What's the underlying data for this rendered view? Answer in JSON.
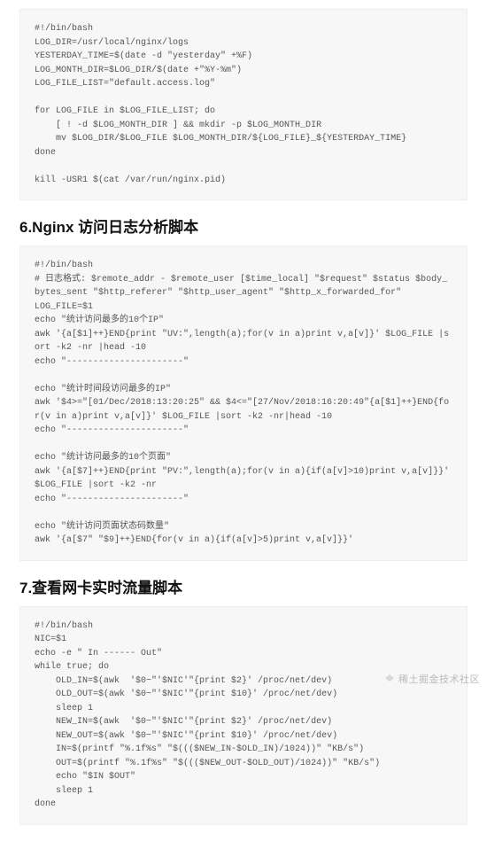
{
  "sections": [
    {
      "code": "#!/bin/bash\nLOG_DIR=/usr/local/nginx/logs\nYESTERDAY_TIME=$(date -d \"yesterday\" +%F)\nLOG_MONTH_DIR=$LOG_DIR/$(date +\"%Y-%m\")\nLOG_FILE_LIST=\"default.access.log\"\n\nfor LOG_FILE in $LOG_FILE_LIST; do\n    [ ! -d $LOG_MONTH_DIR ] && mkdir -p $LOG_MONTH_DIR\n    mv $LOG_DIR/$LOG_FILE $LOG_MONTH_DIR/${LOG_FILE}_${YESTERDAY_TIME}\ndone\n\nkill -USR1 $(cat /var/run/nginx.pid)"
    },
    {
      "heading": "6.Nginx 访问日志分析脚本",
      "code": "#!/bin/bash\n# 日志格式: $remote_addr - $remote_user [$time_local] \"$request\" $status $body_bytes_sent \"$http_referer\" \"$http_user_agent\" \"$http_x_forwarded_for\"\nLOG_FILE=$1\necho \"统计访问最多的10个IP\"\nawk '{a[$1]++}END{print \"UV:\",length(a);for(v in a)print v,a[v]}' $LOG_FILE |sort -k2 -nr |head -10\necho \"----------------------\"\n\necho \"统计时间段访问最多的IP\"\nawk '$4>=\"[01/Dec/2018:13:20:25\" && $4<=\"[27/Nov/2018:16:20:49\"{a[$1]++}END{for(v in a)print v,a[v]}' $LOG_FILE |sort -k2 -nr|head -10\necho \"----------------------\"\n\necho \"统计访问最多的10个页面\"\nawk '{a[$7]++}END{print \"PV:\",length(a);for(v in a){if(a[v]>10)print v,a[v]}}' $LOG_FILE |sort -k2 -nr\necho \"----------------------\"\n\necho \"统计访问页面状态码数量\"\nawk '{a[$7\" \"$9]++}END{for(v in a){if(a[v]>5)print v,a[v]}}'"
    },
    {
      "heading": "7.查看网卡实时流量脚本",
      "code": "#!/bin/bash\nNIC=$1\necho -e \" In ------ Out\"\nwhile true; do\n    OLD_IN=$(awk  '$0~\"'$NIC'\"{print $2}' /proc/net/dev)\n    OLD_OUT=$(awk '$0~\"'$NIC'\"{print $10}' /proc/net/dev)\n    sleep 1\n    NEW_IN=$(awk  '$0~\"'$NIC'\"{print $2}' /proc/net/dev)\n    NEW_OUT=$(awk '$0~\"'$NIC'\"{print $10}' /proc/net/dev)\n    IN=$(printf \"%.1f%s\" \"$((($NEW_IN-$OLD_IN)/1024))\" \"KB/s\")\n    OUT=$(printf \"%.1f%s\" \"$((($NEW_OUT-$OLD_OUT)/1024))\" \"KB/s\")\n    echo \"$IN $OUT\"\n    sleep 1\ndone"
    }
  ],
  "watermark": "稀土掘金技术社区"
}
